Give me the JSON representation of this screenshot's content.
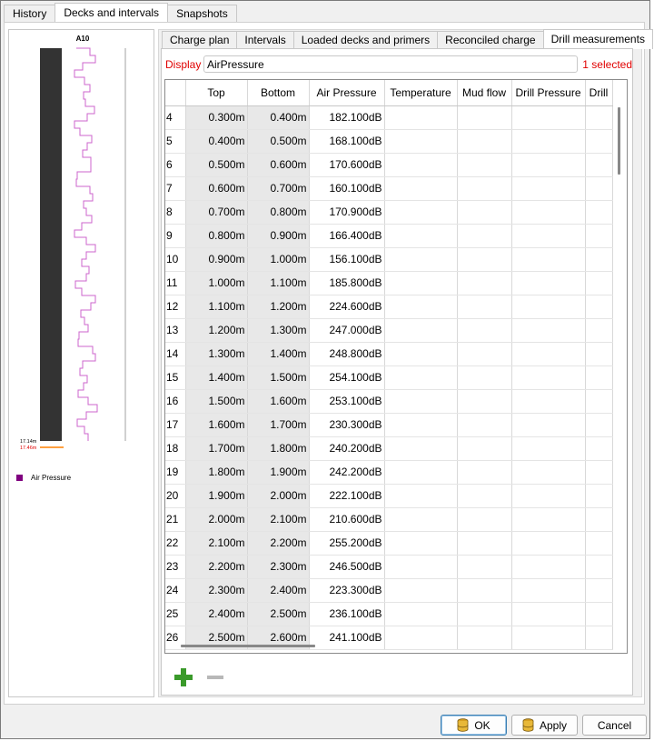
{
  "top_tabs": [
    "History",
    "Decks and intervals",
    "Snapshots"
  ],
  "strip": {
    "hole_name": "A10",
    "depth_label_1": "17.14m",
    "depth_label_2": "17.46m",
    "legend_label": "Air Pressure",
    "legend_color": "#800080"
  },
  "inner_tabs": [
    "Charge plan",
    "Intervals",
    "Loaded decks and primers",
    "Reconciled charge",
    "Drill measurements"
  ],
  "display": {
    "label": "Display",
    "value": "AirPressure",
    "selected": "1 selected"
  },
  "columns": [
    "",
    "Top",
    "Bottom",
    "Air Pressure",
    "Temperature",
    "Mud flow",
    "Drill Pressure",
    "Drill"
  ],
  "rows": [
    {
      "n": "4",
      "top": "0.300m",
      "bottom": "0.400m",
      "air": "182.100dB"
    },
    {
      "n": "5",
      "top": "0.400m",
      "bottom": "0.500m",
      "air": "168.100dB"
    },
    {
      "n": "6",
      "top": "0.500m",
      "bottom": "0.600m",
      "air": "170.600dB"
    },
    {
      "n": "7",
      "top": "0.600m",
      "bottom": "0.700m",
      "air": "160.100dB"
    },
    {
      "n": "8",
      "top": "0.700m",
      "bottom": "0.800m",
      "air": "170.900dB"
    },
    {
      "n": "9",
      "top": "0.800m",
      "bottom": "0.900m",
      "air": "166.400dB"
    },
    {
      "n": "10",
      "top": "0.900m",
      "bottom": "1.000m",
      "air": "156.100dB"
    },
    {
      "n": "11",
      "top": "1.000m",
      "bottom": "1.100m",
      "air": "185.800dB"
    },
    {
      "n": "12",
      "top": "1.100m",
      "bottom": "1.200m",
      "air": "224.600dB"
    },
    {
      "n": "13",
      "top": "1.200m",
      "bottom": "1.300m",
      "air": "247.000dB"
    },
    {
      "n": "14",
      "top": "1.300m",
      "bottom": "1.400m",
      "air": "248.800dB"
    },
    {
      "n": "15",
      "top": "1.400m",
      "bottom": "1.500m",
      "air": "254.100dB"
    },
    {
      "n": "16",
      "top": "1.500m",
      "bottom": "1.600m",
      "air": "253.100dB"
    },
    {
      "n": "17",
      "top": "1.600m",
      "bottom": "1.700m",
      "air": "230.300dB"
    },
    {
      "n": "18",
      "top": "1.700m",
      "bottom": "1.800m",
      "air": "240.200dB"
    },
    {
      "n": "19",
      "top": "1.800m",
      "bottom": "1.900m",
      "air": "242.200dB"
    },
    {
      "n": "20",
      "top": "1.900m",
      "bottom": "2.000m",
      "air": "222.100dB"
    },
    {
      "n": "21",
      "top": "2.000m",
      "bottom": "2.100m",
      "air": "210.600dB"
    },
    {
      "n": "22",
      "top": "2.100m",
      "bottom": "2.200m",
      "air": "255.200dB"
    },
    {
      "n": "23",
      "top": "2.200m",
      "bottom": "2.300m",
      "air": "246.500dB"
    },
    {
      "n": "24",
      "top": "2.300m",
      "bottom": "2.400m",
      "air": "223.300dB"
    },
    {
      "n": "25",
      "top": "2.400m",
      "bottom": "2.500m",
      "air": "236.100dB"
    },
    {
      "n": "26",
      "top": "2.500m",
      "bottom": "2.600m",
      "air": "241.100dB"
    }
  ],
  "buttons": {
    "ok": "OK",
    "apply": "Apply",
    "cancel": "Cancel"
  }
}
